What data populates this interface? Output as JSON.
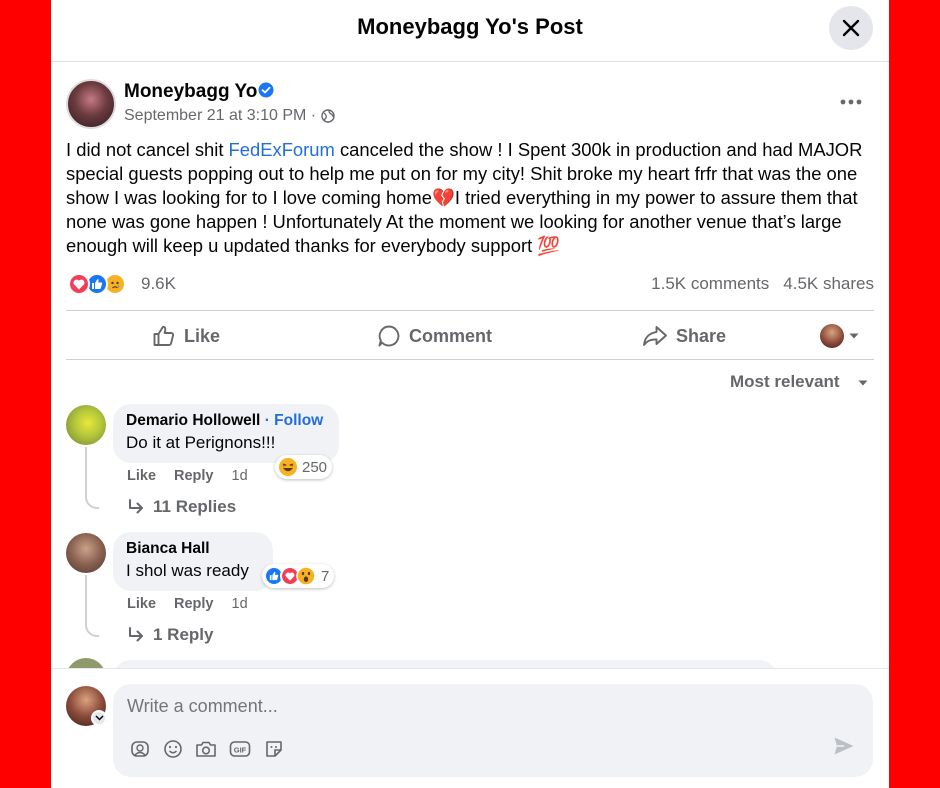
{
  "header": {
    "title": "Moneybagg Yo's Post"
  },
  "post": {
    "author": "Moneybagg Yo",
    "date": "September 21 at 3:10 PM ·",
    "text_before_link": "I did not cancel shit ",
    "link": "FedExForum",
    "text_part_1": " canceled the show ! I Spent 300k in production and had MAJOR special guests popping out to help me put on for my city! Shit broke my heart frfr that was the one show I was looking for to I love coming home",
    "broken_heart_emoji": "💔",
    "text_part_2": "I tried everything in my power to assure them that none was gone happen ! Unfortunately At the moment we looking for another venue that’s large enough will keep u updated thanks for everybody support ",
    "hundred_emoji": "💯",
    "reaction_count": "9.6K",
    "comments_count": "1.5K comments",
    "shares_count": "4.5K shares"
  },
  "actions": {
    "like": "Like",
    "comment": "Comment",
    "share": "Share"
  },
  "sort": {
    "label": "Most relevant"
  },
  "comments": [
    {
      "name": "Demario Hollowell",
      "follow": "· Follow",
      "text": "Do it at Perignons!!!",
      "like": "Like",
      "reply": "Reply",
      "time": "1d",
      "reaction_count": "250",
      "replies": "11 Replies"
    },
    {
      "name": "Bianca Hall",
      "text": "I shol was ready",
      "like": "Like",
      "reply": "Reply",
      "time": "1d",
      "reaction_count": "7",
      "replies": "1 Reply"
    }
  ],
  "composer": {
    "placeholder": "Write a comment..."
  },
  "colors": {
    "brand_blue": "#216fdb",
    "background_red": "#fe0000",
    "like_blue": "#1877f2",
    "love_red": "#f33e58"
  },
  "icons": [
    "close-icon",
    "verified-icon",
    "globe-icon",
    "more-icon",
    "like-icon",
    "comment-icon",
    "share-icon",
    "caret-down-icon",
    "reply-arrow-icon",
    "sticker-icon",
    "emoji-icon",
    "camera-icon",
    "gif-icon",
    "avatar-sticker-icon",
    "send-icon"
  ]
}
